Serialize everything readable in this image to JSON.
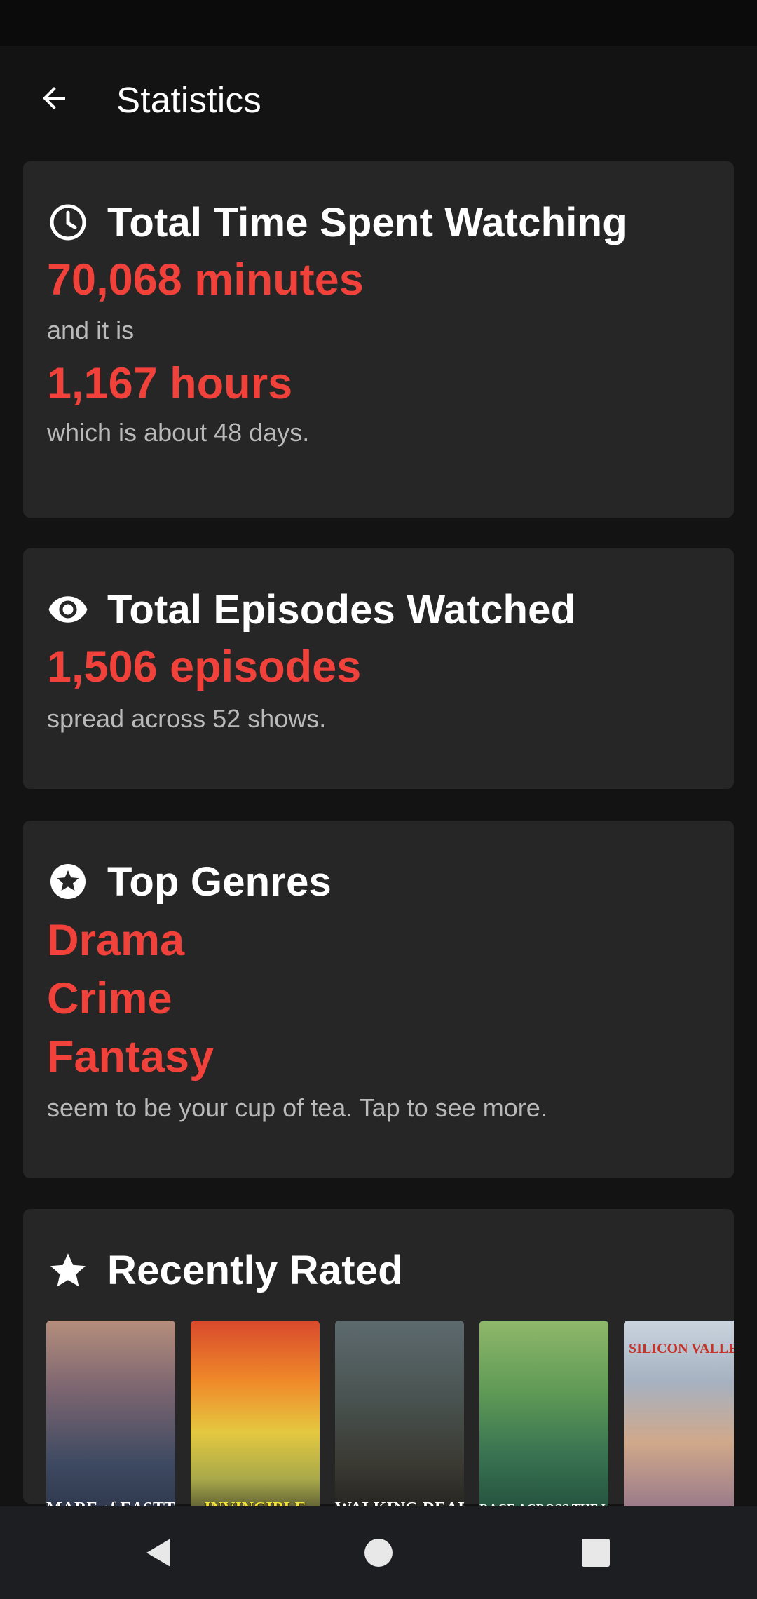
{
  "app_bar": {
    "title": "Statistics",
    "back_icon": "arrow-left-icon"
  },
  "cards": {
    "time": {
      "icon": "clock-icon",
      "title": "Total Time Spent Watching",
      "minutes": "70,068 minutes",
      "connector": "and it is",
      "hours": "1,167 hours",
      "days_text": "which is about 48 days."
    },
    "episodes": {
      "icon": "eye-icon",
      "title": "Total Episodes Watched",
      "count": "1,506 episodes",
      "shows_text": "spread across 52 shows."
    },
    "genres": {
      "icon": "star-circle-icon",
      "title": "Top Genres",
      "items": [
        "Drama",
        "Crime",
        "Fantasy"
      ],
      "footer": "seem to be your cup of tea. Tap to see more."
    },
    "rated": {
      "icon": "star-icon",
      "title": "Recently Rated",
      "posters": [
        {
          "label": "MARE of EASTTOWN"
        },
        {
          "label": "INVINCIBLE"
        },
        {
          "label": "WALKING DEAD"
        },
        {
          "label": "RACE ACROSS THE WORLD"
        },
        {
          "label": "SILICON VALLEY"
        }
      ]
    }
  },
  "nav_bar": {
    "back": "nav-back-icon",
    "home": "nav-home-icon",
    "recents": "nav-recents-icon"
  },
  "colors": {
    "accent": "#f0423a",
    "card_bg": "#262626",
    "page_bg": "#131313"
  }
}
